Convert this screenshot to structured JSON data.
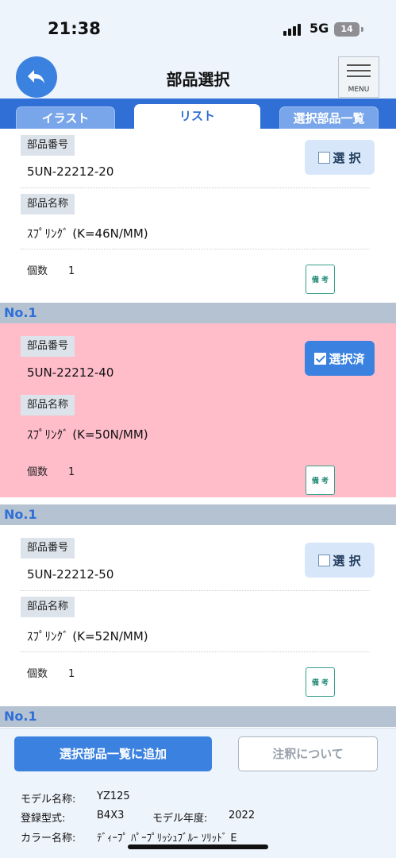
{
  "status_bar": {
    "time": "21:38",
    "network": "5G",
    "battery": "14"
  },
  "header": {
    "title": "部品選択",
    "menu_label": "MENU"
  },
  "tabs": [
    {
      "label": "イラスト",
      "active": false
    },
    {
      "label": "リスト",
      "active": true
    },
    {
      "label": "選択部品一覧",
      "active": false
    }
  ],
  "labels": {
    "part_number": "部品番号",
    "part_name": "部品名称",
    "quantity": "個数",
    "note": "備 考"
  },
  "parts": [
    {
      "part_number": "5UN-22212-20",
      "part_name": "ｽﾌﾟﾘﾝｸﾞ (K=46N/MM)",
      "quantity": "1",
      "select_label": "選 択",
      "selected": false,
      "no_label": "No.1"
    },
    {
      "part_number": "5UN-22212-40",
      "part_name": "ｽﾌﾟﾘﾝｸﾞ (K=50N/MM)",
      "quantity": "1",
      "select_label": "選択済",
      "selected": true,
      "no_label": "No.1"
    },
    {
      "part_number": "5UN-22212-50",
      "part_name": "ｽﾌﾟﾘﾝｸﾞ (K=52N/MM)",
      "quantity": "1",
      "select_label": "選 択",
      "selected": false,
      "no_label": "No.1"
    }
  ],
  "actions": {
    "add_to_list": "選択部品一覧に追加",
    "about_notes": "注釈について"
  },
  "model_info": {
    "model_name_label": "モデル名称:",
    "model_name": "YZ125",
    "registration_label": "登録型式:",
    "registration": "B4X3",
    "model_year_label": "モデル年度:",
    "model_year": "2022",
    "color_label": "カラー名称:",
    "color": "ﾃﾞｨｰﾌﾟ ﾊﾟｰﾌﾟﾘｯｼｭﾌﾞﾙｰ ｿﾘｯﾄﾞ E"
  },
  "colors": {
    "accent": "#3b82e0",
    "tab_bar": "#2f6fd6",
    "selected_row": "#ffbdca",
    "note_border": "#3aa08c"
  }
}
